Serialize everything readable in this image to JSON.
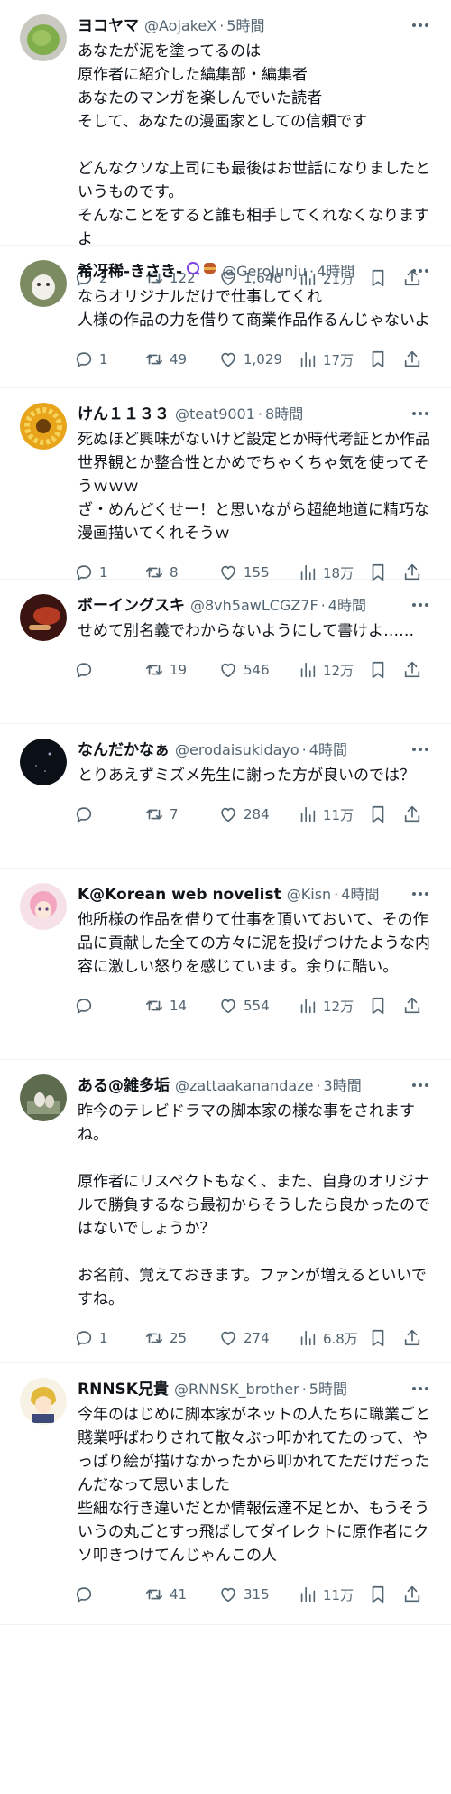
{
  "feed": {
    "posts": [
      {
        "name": "ヨコヤマ",
        "handle": "@AojakeX",
        "time": "5時間",
        "text": "あなたが泥を塗ってるのは\n原作者に紹介した編集部・編集者\nあなたのマンガを楽しんでいた読者\nそして、あなたの漫画家としての信頼です\n\nどんなクソな上司にも最後はお世話になりましたというものです。\nそんなことをすると誰も相手してくれなくなりますよ",
        "replies": "2",
        "reposts": "122",
        "likes": "1,646",
        "views": "21万",
        "avatar_color": "#7fae4a"
      },
      {
        "name": "希冴稀-きさき-",
        "handle": "@GeroJunju",
        "time": "4時間",
        "text": "ならオリジナルだけで仕事してくれ\n人様の作品の力を借りて商業作品作るんじゃないよ",
        "replies": "1",
        "reposts": "49",
        "likes": "1,029",
        "views": "17万",
        "avatar_color": "#cfd5c6"
      },
      {
        "name": "けん１１３３",
        "handle": "@teat9001",
        "time": "8時間",
        "text": "死ぬほど興味がないけど設定とか時代考証とか作品世界観とか整合性とかめでちゃくちゃ気を使ってそうｗｗｗ\nざ・めんどくせー！と思いながら超絶地道に精巧な漫画描いてくれそうｗ",
        "replies": "1",
        "reposts": "8",
        "likes": "155",
        "views": "18万",
        "avatar_color": "#e8a51c"
      },
      {
        "name": "ボーイングスキ",
        "handle": "@8vh5awLCGZ7F",
        "time": "4時間",
        "text": "せめて別名義でわからないようにして書けよ……",
        "replies": "",
        "reposts": "19",
        "likes": "546",
        "views": "12万",
        "avatar_color": "#8a2a1f"
      },
      {
        "name": "なんだかなぁ",
        "handle": "@erodaisukidayo",
        "time": "4時間",
        "text": "とりあえずミズメ先生に謝った方が良いのでは？",
        "replies": "",
        "reposts": "7",
        "likes": "284",
        "views": "11万",
        "avatar_color": "#11161f"
      },
      {
        "name": "K@Korean web novelist",
        "handle": "@Kisn",
        "time": "4時間",
        "text": "他所様の作品を借りて仕事を頂いておいて、その作品に貢献した全ての方々に泥を投げつけたような内容に激しい怒りを感じています。余りに酷い。",
        "replies": "",
        "reposts": "14",
        "likes": "554",
        "views": "12万",
        "avatar_color": "#f2b8c8"
      },
      {
        "name": "ある@雑多垢",
        "handle": "@zattaakanandaze",
        "time": "3時間",
        "text": "昨今のテレビドラマの脚本家の様な事をされますね。\n\n原作者にリスペクトもなく、また、自身のオリジナルで勝負するなら最初からそうしたら良かったのではないでしょうか？\n\nお名前、覚えておきます。ファンが増えるといいですね。",
        "replies": "1",
        "reposts": "25",
        "likes": "274",
        "views": "6.8万",
        "avatar_color": "#6d7a60"
      },
      {
        "name": "RNNSK兄貴",
        "handle": "@RNNSK_brother",
        "time": "5時間",
        "text": "今年のはじめに脚本家がネットの人たちに職業ごと賤業呼ばわりされて散々ぶっ叩かれてたのって、やっぱり絵が描けなかったから叩かれてただけだったんだなって思いました\n些細な行き違いだとか情報伝達不足とか、もうそういうの丸ごとすっ飛ばしてダイレクトに原作者にクソ叩きつけてんじゃんこの人",
        "replies": "",
        "reposts": "41",
        "likes": "315",
        "views": "11万",
        "avatar_color": "#e9d9a6"
      }
    ]
  }
}
